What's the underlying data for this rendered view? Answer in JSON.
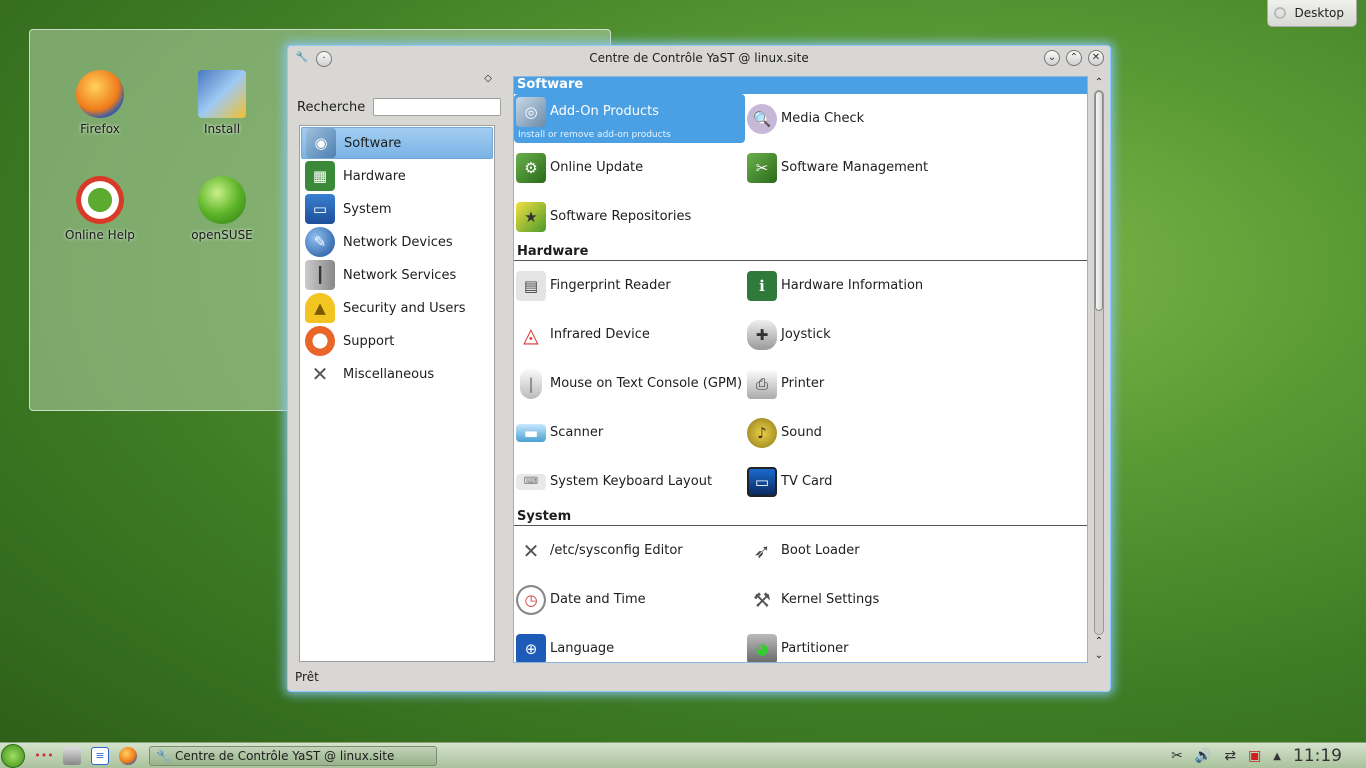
{
  "desktop": {
    "folder_icons": [
      {
        "label": "Firefox",
        "icon": "firefox-icon"
      },
      {
        "label": "Install",
        "icon": "install-icon"
      },
      {
        "label": "Online Help",
        "icon": "help-lifebuoy-icon"
      },
      {
        "label": "openSUSE",
        "icon": "opensuse-icon"
      }
    ],
    "desktop_button": "Desktop"
  },
  "window": {
    "title": "Centre de Contrôle YaST @ linux.site",
    "search_label": "Recherche",
    "search_value": "",
    "status": "Prêt",
    "categories": [
      {
        "label": "Software",
        "icon": "software-icon",
        "active": true
      },
      {
        "label": "Hardware",
        "icon": "hardware-icon"
      },
      {
        "label": "System",
        "icon": "system-monitor-icon"
      },
      {
        "label": "Network Devices",
        "icon": "network-globe-icon"
      },
      {
        "label": "Network Services",
        "icon": "network-services-icon"
      },
      {
        "label": "Security and Users",
        "icon": "security-helmet-icon"
      },
      {
        "label": "Support",
        "icon": "support-lifebuoy-icon"
      },
      {
        "label": "Miscellaneous",
        "icon": "tools-icon"
      }
    ],
    "sections": [
      {
        "title": "Software",
        "items": [
          {
            "label": "Add-On Products",
            "desc": "Install or remove add-on products",
            "icon": "addon-cd-icon"
          },
          {
            "label": "Media Check",
            "icon": "media-check-icon"
          },
          {
            "label": "Online Update",
            "icon": "online-update-icon"
          },
          {
            "label": "Software Management",
            "icon": "software-management-icon"
          },
          {
            "label": "Software Repositories",
            "icon": "repositories-icon"
          }
        ]
      },
      {
        "title": "Hardware",
        "items": [
          {
            "label": "Fingerprint Reader",
            "icon": "fingerprint-icon"
          },
          {
            "label": "Hardware Information",
            "icon": "hardware-info-icon"
          },
          {
            "label": "Infrared Device",
            "icon": "infrared-icon"
          },
          {
            "label": "Joystick",
            "icon": "joystick-icon"
          },
          {
            "label": "Mouse on Text Console (GPM)",
            "icon": "mouse-icon"
          },
          {
            "label": "Printer",
            "icon": "printer-icon"
          },
          {
            "label": "Scanner",
            "icon": "scanner-icon"
          },
          {
            "label": "Sound",
            "icon": "sound-icon"
          },
          {
            "label": "System Keyboard Layout",
            "icon": "keyboard-icon"
          },
          {
            "label": "TV Card",
            "icon": "tv-icon"
          }
        ]
      },
      {
        "title": "System",
        "items": [
          {
            "label": "/etc/sysconfig Editor",
            "icon": "sysconfig-tools-icon"
          },
          {
            "label": "Boot Loader",
            "icon": "boot-rocket-icon"
          },
          {
            "label": "Date and Time",
            "icon": "clock-icon"
          },
          {
            "label": "Kernel Settings",
            "icon": "kernel-wrench-icon"
          },
          {
            "label": "Language",
            "icon": "language-flag-icon"
          },
          {
            "label": "Partitioner",
            "icon": "partitioner-disk-icon"
          }
        ]
      }
    ]
  },
  "taskbar": {
    "task_label": "Centre de Contrôle YaST @ linux.site",
    "clock": "11:19"
  }
}
